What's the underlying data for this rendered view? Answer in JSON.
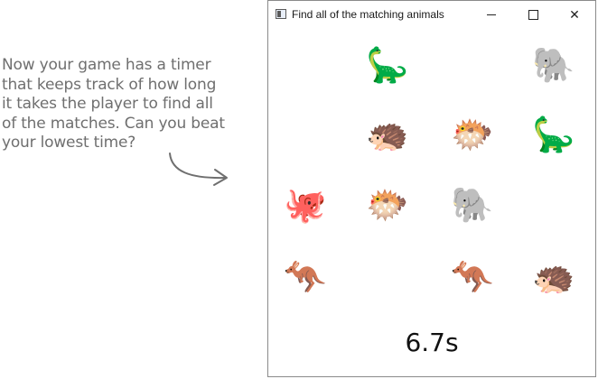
{
  "annotation": {
    "lines": [
      "Now your game has a timer",
      "that keeps track of how long",
      "it takes the player to find all",
      "of the matches. Can you beat",
      "your lowest time?"
    ]
  },
  "window": {
    "title": "Find all of the matching animals",
    "close_glyph": "✕"
  },
  "grid": {
    "cells": [
      {
        "row": 0,
        "col": 0,
        "animal": "",
        "icon": "empty"
      },
      {
        "row": 0,
        "col": 1,
        "animal": "🦕",
        "icon": "dinosaur-icon"
      },
      {
        "row": 0,
        "col": 2,
        "animal": "",
        "icon": "empty"
      },
      {
        "row": 0,
        "col": 3,
        "animal": "🐘",
        "icon": "elephant-icon"
      },
      {
        "row": 1,
        "col": 0,
        "animal": "",
        "icon": "empty"
      },
      {
        "row": 1,
        "col": 1,
        "animal": "🦔",
        "icon": "hedgehog-icon"
      },
      {
        "row": 1,
        "col": 2,
        "animal": "🐡",
        "icon": "blowfish-icon"
      },
      {
        "row": 1,
        "col": 3,
        "animal": "🦕",
        "icon": "dinosaur-icon"
      },
      {
        "row": 2,
        "col": 0,
        "animal": "🐙",
        "icon": "octopus-icon"
      },
      {
        "row": 2,
        "col": 1,
        "animal": "🐡",
        "icon": "blowfish-icon"
      },
      {
        "row": 2,
        "col": 2,
        "animal": "🐘",
        "icon": "elephant-icon"
      },
      {
        "row": 2,
        "col": 3,
        "animal": "",
        "icon": "empty"
      },
      {
        "row": 3,
        "col": 0,
        "animal": "🦘",
        "icon": "kangaroo-icon"
      },
      {
        "row": 3,
        "col": 1,
        "animal": "",
        "icon": "empty"
      },
      {
        "row": 3,
        "col": 2,
        "animal": "🦘",
        "icon": "kangaroo-icon"
      },
      {
        "row": 3,
        "col": 3,
        "animal": "🦔",
        "icon": "hedgehog-icon"
      }
    ]
  },
  "timer": {
    "text": "6.7s"
  }
}
